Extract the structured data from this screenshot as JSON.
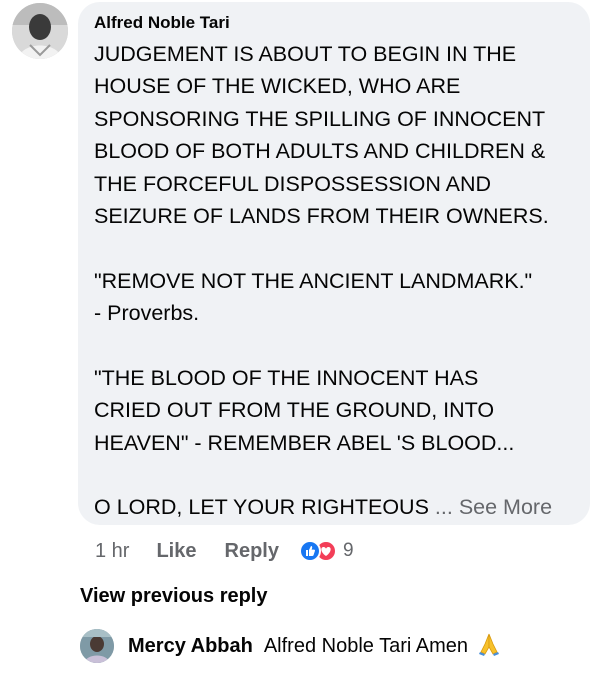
{
  "comment": {
    "author": "Alfred Noble Tari",
    "lines": [
      "JUDGEMENT IS ABOUT TO BEGIN IN THE",
      "HOUSE OF THE WICKED, WHO ARE",
      "SPONSORING THE SPILLING OF INNOCENT",
      "BLOOD OF BOTH ADULTS AND CHILDREN &",
      "THE FORCEFUL DISPOSSESSION AND",
      "SEIZURE OF LANDS FROM THEIR OWNERS.",
      "",
      "\"REMOVE NOT THE ANCIENT LANDMARK.\"",
      "- Proverbs.",
      "",
      "\"THE BLOOD OF THE INNOCENT HAS",
      "CRIED OUT FROM  THE GROUND, INTO",
      "HEAVEN\" - REMEMBER ABEL 'S BLOOD...",
      ""
    ],
    "last_line": "O LORD, LET YOUR RIGHTEOUS",
    "ellipsis": "...",
    "see_more": "See More"
  },
  "actions": {
    "time": "1 hr",
    "like": "Like",
    "reply": "Reply",
    "reaction_count": "9",
    "reaction_types": [
      "like-icon",
      "love-icon"
    ],
    "colors": {
      "like": "#1877f2",
      "love": "#f33e58"
    }
  },
  "view_previous_reply": "View previous reply",
  "reply": {
    "author": "Mercy Abbah",
    "text": "Alfred Noble Tari Amen",
    "emoji_icon": "folded-hands-icon"
  }
}
